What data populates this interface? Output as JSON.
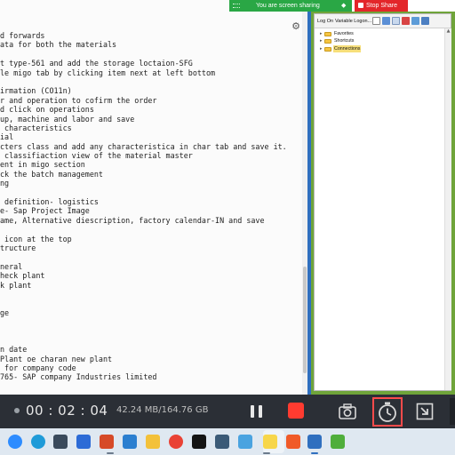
{
  "editor": {
    "lines": [
      "d forwards",
      "ata for both the materials",
      "",
      "t type-561 and add the storage loctaion-SFG",
      "le migo tab by clicking item next at left bottom",
      "",
      "irmation (CO11n)",
      "r and operation to cofirm the order",
      "d click on operations",
      "up, machine and labor and save",
      " characteristics",
      "ial",
      "cters class and add any characteristica in char tab and save it.",
      " classifiaction view of the material master",
      "ent in migo section",
      "ck the batch management",
      "ng",
      "",
      " definition- logistics",
      "e- Sap Project Image",
      "ame, Alternative diescription, factory calendar-IN and save",
      "",
      " icon at the top",
      "tructure",
      "",
      "neral",
      "heck plant",
      "k plant",
      "",
      "",
      "ge",
      "",
      "",
      "",
      "n date",
      "Plant oe charan new plant",
      " for company code",
      "765- SAP company Industries limited"
    ]
  },
  "sharing": {
    "status_text": "You are screen sharing",
    "stop_label": "Stop Share",
    "colors": {
      "status": "#2aa745",
      "stop": "#e3262a"
    }
  },
  "sap_logon": {
    "tabs": [
      "Log On",
      "Variable Logon..."
    ],
    "tree": [
      {
        "label": "Favorites",
        "selected": false
      },
      {
        "label": "Shortcuts",
        "selected": false
      },
      {
        "label": "Connections",
        "selected": true
      }
    ]
  },
  "recorder": {
    "timer": "00 : 02 : 04",
    "file_size": "42.24 MB/164.76 GB",
    "colors": {
      "stop": "#ff3b30",
      "highlight": "#ff4b4b"
    }
  },
  "taskbar": {
    "apps": [
      "zoom-icon",
      "edge-icon",
      "store-icon",
      "dropbox-icon",
      "office-icon",
      "vscode-icon",
      "file-explorer-icon",
      "chrome-icon",
      "netflix-icon",
      "calculator-icon",
      "photos-icon",
      "sticky-notes-icon",
      "brave-icon",
      "mail-icon",
      "green-app-icon"
    ]
  }
}
